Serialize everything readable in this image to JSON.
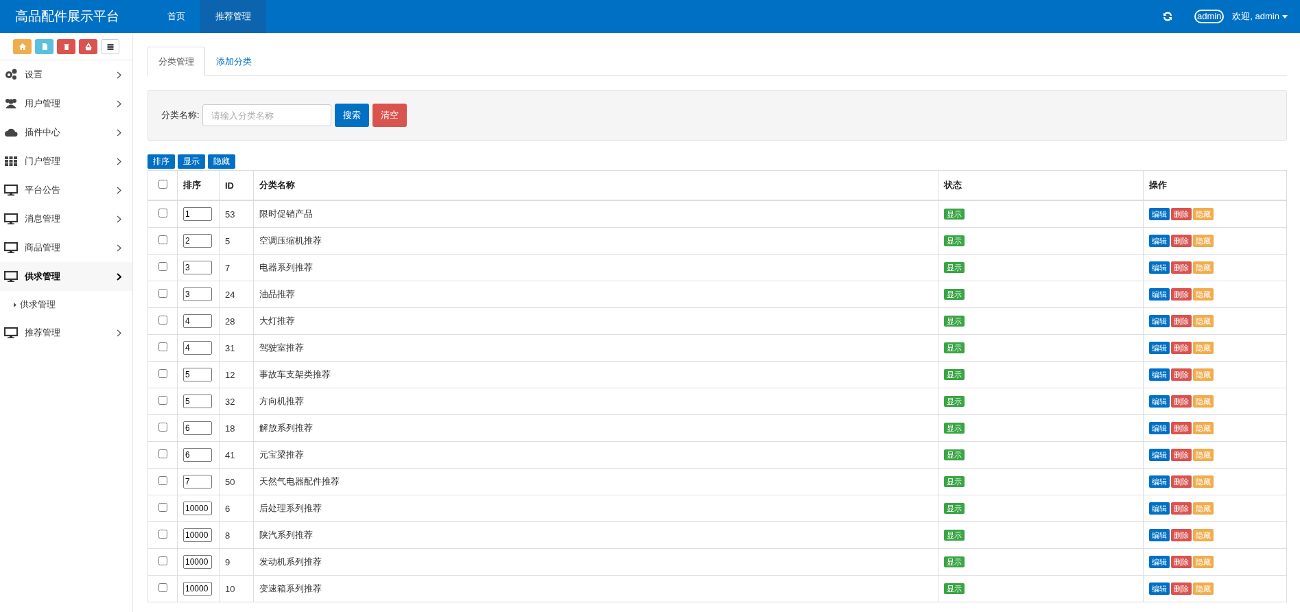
{
  "header": {
    "title": "高品配件展示平台",
    "nav": [
      {
        "label": "首页",
        "selected": false
      },
      {
        "label": "推荐管理",
        "selected": true
      }
    ],
    "user_badge": "admin",
    "welcome": "欢迎, admin"
  },
  "sidebar": {
    "items": [
      {
        "label": "设置",
        "kind": "gears",
        "selected": false
      },
      {
        "label": "用户管理",
        "kind": "users",
        "selected": false
      },
      {
        "label": "插件中心",
        "kind": "cloud",
        "selected": false
      },
      {
        "label": "门户管理",
        "kind": "grid",
        "selected": false
      },
      {
        "label": "平台公告",
        "kind": "monitor",
        "selected": false
      },
      {
        "label": "消息管理",
        "kind": "monitor",
        "selected": false
      },
      {
        "label": "商品管理",
        "kind": "monitor",
        "selected": false
      },
      {
        "label": "供求管理",
        "kind": "monitor",
        "selected": true,
        "children": [
          {
            "label": "供求管理"
          }
        ]
      },
      {
        "label": "推荐管理",
        "kind": "monitor",
        "selected": false
      }
    ]
  },
  "tabs": [
    {
      "label": "分类管理",
      "selected": true
    },
    {
      "label": "添加分类",
      "selected": false
    }
  ],
  "search": {
    "label": "分类名称:",
    "placeholder": "请输入分类名称",
    "buttons": [
      {
        "label": "搜索",
        "kind": "primary"
      },
      {
        "label": "清空",
        "kind": "danger"
      }
    ]
  },
  "bulk_actions": [
    "排序",
    "显示",
    "隐藏"
  ],
  "table": {
    "header_checked": false,
    "columns": [
      "排序",
      "ID",
      "分类名称",
      "状态",
      "操作"
    ],
    "rows": [
      {
        "checked": false,
        "order": "1",
        "id": "53",
        "name": "限时促销产品",
        "status": "显示",
        "actions": [
          "编辑",
          "删除",
          "隐藏"
        ]
      },
      {
        "checked": false,
        "order": "2",
        "id": "5",
        "name": "空调压缩机推荐",
        "status": "显示",
        "actions": [
          "编辑",
          "删除",
          "隐藏"
        ]
      },
      {
        "checked": false,
        "order": "3",
        "id": "7",
        "name": "电器系列推荐",
        "status": "显示",
        "actions": [
          "编辑",
          "删除",
          "隐藏"
        ]
      },
      {
        "checked": false,
        "order": "3",
        "id": "24",
        "name": "油品推荐",
        "status": "显示",
        "actions": [
          "编辑",
          "删除",
          "隐藏"
        ]
      },
      {
        "checked": false,
        "order": "4",
        "id": "28",
        "name": "大灯推荐",
        "status": "显示",
        "actions": [
          "编辑",
          "删除",
          "隐藏"
        ]
      },
      {
        "checked": false,
        "order": "4",
        "id": "31",
        "name": "驾驶室推荐",
        "status": "显示",
        "actions": [
          "编辑",
          "删除",
          "隐藏"
        ]
      },
      {
        "checked": false,
        "order": "5",
        "id": "12",
        "name": "事故车支架类推荐",
        "status": "显示",
        "actions": [
          "编辑",
          "删除",
          "隐藏"
        ]
      },
      {
        "checked": false,
        "order": "5",
        "id": "32",
        "name": "方向机推荐",
        "status": "显示",
        "actions": [
          "编辑",
          "删除",
          "隐藏"
        ]
      },
      {
        "checked": false,
        "order": "6",
        "id": "18",
        "name": "解放系列推荐",
        "status": "显示",
        "actions": [
          "编辑",
          "删除",
          "隐藏"
        ]
      },
      {
        "checked": false,
        "order": "6",
        "id": "41",
        "name": "元宝梁推荐",
        "status": "显示",
        "actions": [
          "编辑",
          "删除",
          "隐藏"
        ]
      },
      {
        "checked": false,
        "order": "7",
        "id": "50",
        "name": "天然气电器配件推荐",
        "status": "显示",
        "actions": [
          "编辑",
          "删除",
          "隐藏"
        ]
      },
      {
        "checked": false,
        "order": "10000",
        "id": "6",
        "name": "后处理系列推荐",
        "status": "显示",
        "actions": [
          "编辑",
          "删除",
          "隐藏"
        ]
      },
      {
        "checked": false,
        "order": "10000",
        "id": "8",
        "name": "陕汽系列推荐",
        "status": "显示",
        "actions": [
          "编辑",
          "删除",
          "隐藏"
        ]
      },
      {
        "checked": false,
        "order": "10000",
        "id": "9",
        "name": "发动机系列推荐",
        "status": "显示",
        "actions": [
          "编辑",
          "删除",
          "隐藏"
        ]
      },
      {
        "checked": false,
        "order": "10000",
        "id": "10",
        "name": "变速箱系列推荐",
        "status": "显示",
        "actions": [
          "编辑",
          "删除",
          "隐藏"
        ]
      }
    ]
  }
}
